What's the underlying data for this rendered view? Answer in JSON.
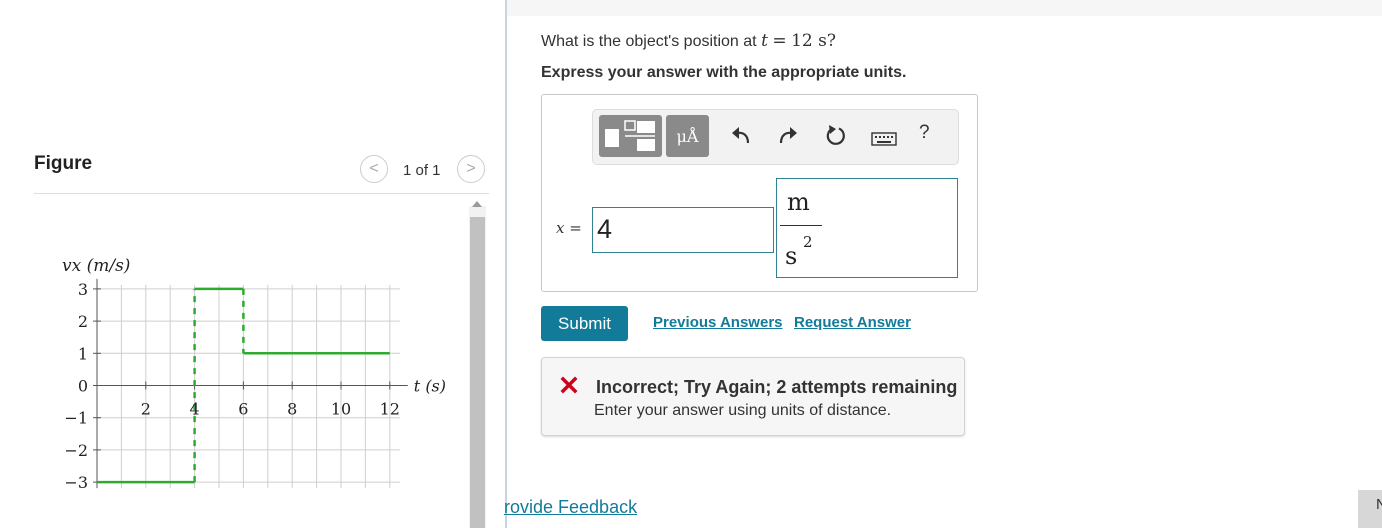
{
  "figure": {
    "title": "Figure",
    "pager_prev": "<",
    "pager_next": ">",
    "pager_text": "1 of 1"
  },
  "chart_data": {
    "type": "line",
    "x_label": "t (s)",
    "y_label": "vx (m/s)",
    "x_ticks": [
      "2",
      "4",
      "6",
      "8",
      "10",
      "12"
    ],
    "y_ticks": [
      "3",
      "2",
      "1",
      "0",
      "−1",
      "−2",
      "−3"
    ],
    "xlim": [
      0,
      12
    ],
    "ylim": [
      -3,
      3
    ],
    "grid": true,
    "series": [
      {
        "x": [
          0,
          4,
          4,
          6,
          6,
          12
        ],
        "y": [
          -3,
          -3,
          3,
          3,
          1,
          1
        ]
      }
    ],
    "colors": {
      "line": "#2eaa2e",
      "grid": "#cfcfcf",
      "axis": "#555555"
    }
  },
  "question": {
    "prefix": "What is the object's position at",
    "var": "t",
    "eq": "=",
    "value": "12 s?"
  },
  "instruction": "Express your answer with the appropriate units.",
  "toolbar": {
    "unit_label": "μÅ",
    "help": "?",
    "icons": [
      "templates-icon",
      "units-icon",
      "undo-icon",
      "redo-icon",
      "reset-icon",
      "keyboard-icon",
      "help-icon"
    ]
  },
  "answer": {
    "var_label": "x =",
    "value": "4",
    "unit_num": "m",
    "unit_den": "s",
    "unit_exp": "2"
  },
  "actions": {
    "submit": "Submit",
    "previous": "Previous Answers",
    "request": "Request Answer"
  },
  "feedback": {
    "title": "Incorrect; Try Again; 2 attempts remaining",
    "message": "Enter your answer using units of distance."
  },
  "footer": {
    "provide_feedback": "rovide Feedback",
    "next": "N"
  },
  "colors": {
    "accent": "#137b9a",
    "error": "#d0021b"
  }
}
